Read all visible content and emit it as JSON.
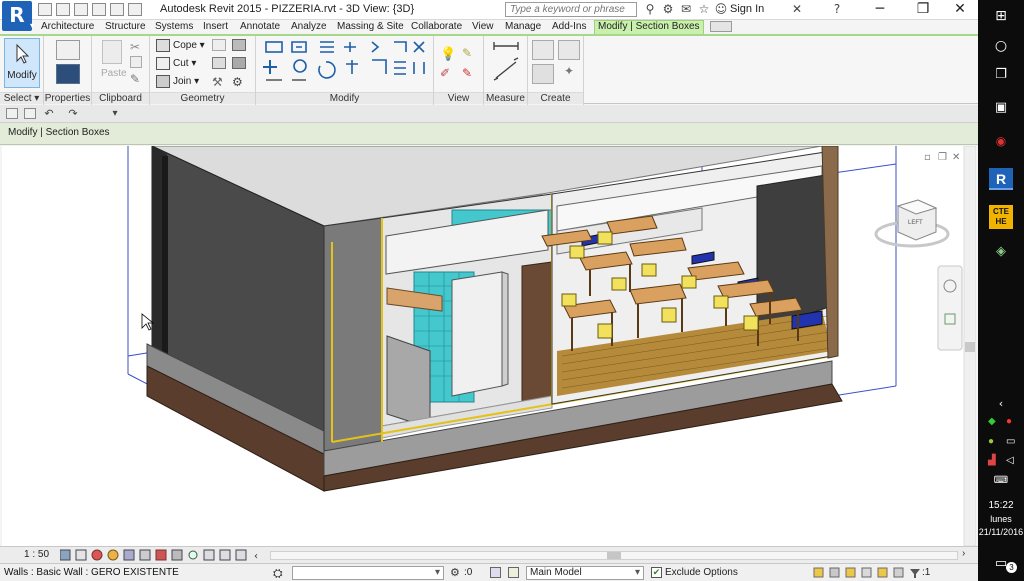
{
  "title_bar": {
    "app_title": "Autodesk Revit 2015 -      PIZZERIA.rvt - 3D View: {3D}",
    "search_placeholder": "Type a keyword or phrase",
    "sign_in": "Sign In",
    "logo_letter": "R"
  },
  "tabs": [
    "Architecture",
    "Structure",
    "Systems",
    "Insert",
    "Annotate",
    "Analyze",
    "Massing & Site",
    "Collaborate",
    "View",
    "Manage",
    "Add-Ins",
    "Modify | Section Boxes"
  ],
  "active_tab": "Modify | Section Boxes",
  "ribbon": {
    "select": {
      "modify_label": "Modify",
      "panel_label": "Select"
    },
    "properties": {
      "panel_label": "Properties"
    },
    "clipboard": {
      "paste_label": "Paste",
      "panel_label": "Clipboard"
    },
    "geometry": {
      "cope_label": "Cope",
      "cut_label": "Cut",
      "join_label": "Join",
      "panel_label": "Geometry"
    },
    "modify": {
      "panel_label": "Modify"
    },
    "view": {
      "panel_label": "View"
    },
    "measure": {
      "panel_label": "Measure"
    },
    "create": {
      "panel_label": "Create"
    }
  },
  "options_bar": {
    "context_label": "Modify | Section Boxes"
  },
  "view_control": {
    "scale": "1 : 50"
  },
  "status_bar": {
    "status_text": "Walls : Basic Wall : GERO EXISTENTE",
    "workset_value": ":0",
    "design_option": "Main Model",
    "exclude_options": "Exclude Options",
    "filter_count": ":1"
  },
  "viewcube": {
    "face_label": "LEFT"
  },
  "taskbar": {
    "clock_time": "15:22",
    "clock_day": "lunes",
    "clock_date": "21/11/2016",
    "notification_count": "3",
    "cte_label_top": "CTE",
    "cte_label_bottom": "HE"
  },
  "colors": {
    "ribbon_accent": "#a6d78a",
    "active_tab": "#c9f0ad",
    "revit_blue": "#1f63b8",
    "taskbar": "#0c0c0c"
  }
}
